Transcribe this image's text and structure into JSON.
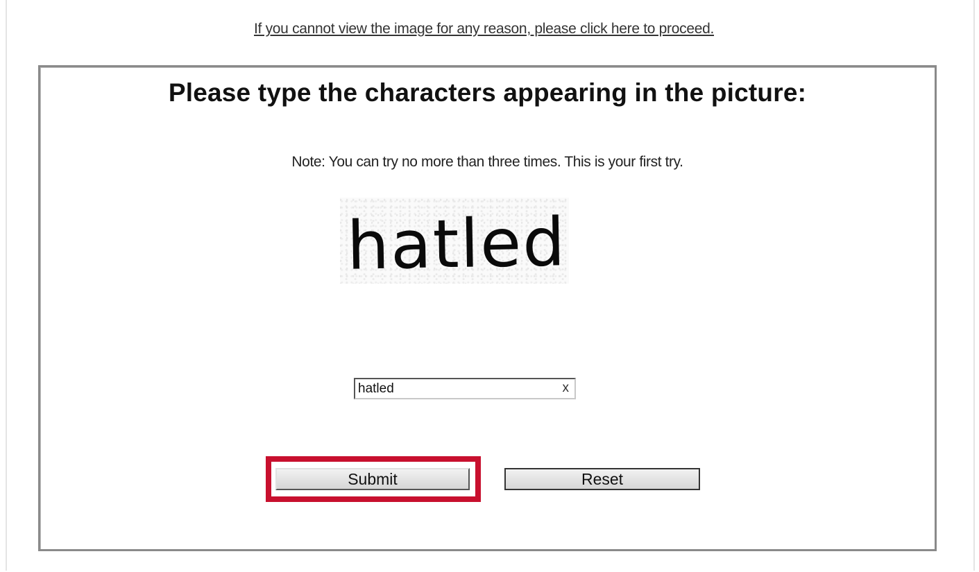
{
  "proceed_link": {
    "text": "If you cannot view the image for any reason, please click here to proceed."
  },
  "captcha": {
    "heading": "Please type the characters appearing in the picture:",
    "note": "Note: You can try no more than three times. This is your first try.",
    "image_text": "hatled",
    "input_value": "hatled",
    "clear_symbol": "x"
  },
  "buttons": {
    "submit_label": "Submit",
    "reset_label": "Reset"
  },
  "colors": {
    "highlight": "#c8102e",
    "panel_border": "#8a8a8a"
  }
}
